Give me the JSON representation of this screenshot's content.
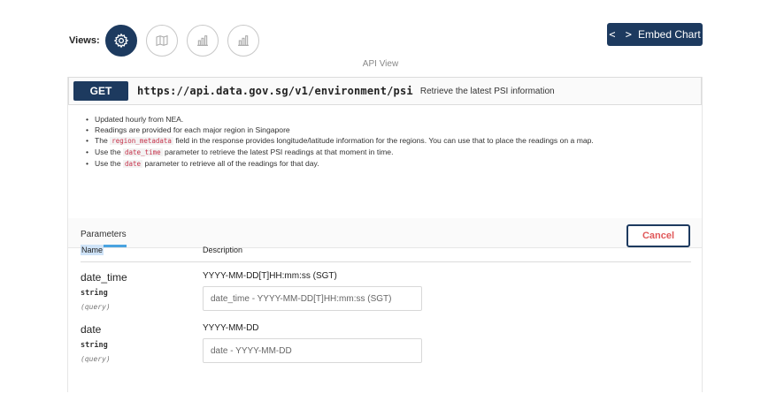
{
  "views": {
    "label": "Views:",
    "buttons": [
      {
        "icon": "gear-icon",
        "active": true
      },
      {
        "icon": "map-icon",
        "active": false
      },
      {
        "icon": "bar-chart-icon",
        "active": false
      },
      {
        "icon": "bar-chart-icon",
        "active": false
      }
    ]
  },
  "embed": {
    "code_glyph": "< >",
    "label": "Embed Chart"
  },
  "api_view_label": "API View",
  "operation": {
    "method": "GET",
    "path": "https://api.data.gov.sg/v1/environment/psi",
    "summary": "Retrieve the latest PSI information"
  },
  "description": {
    "items": [
      {
        "pre": "Updated hourly from NEA.",
        "code": "",
        "post": ""
      },
      {
        "pre": "Readings are provided for each major region in Singapore",
        "code": "",
        "post": ""
      },
      {
        "pre": "The ",
        "code": "region_metadata",
        "post": " field in the response provides longitude/latitude information for the regions. You can use that to place the readings on a map."
      },
      {
        "pre": "Use the ",
        "code": "date_time",
        "post": " parameter to retrieve the latest PSI readings at that moment in time."
      },
      {
        "pre": "Use the ",
        "code": "date",
        "post": " parameter to retrieve all of the readings for that day."
      }
    ]
  },
  "parameters": {
    "tab_label": "Parameters",
    "cancel_label": "Cancel",
    "headers": {
      "name": "Name",
      "description": "Description"
    },
    "rows": [
      {
        "name": "date_time",
        "type": "string",
        "in": "(query)",
        "description": "YYYY-MM-DD[T]HH:mm:ss (SGT)",
        "placeholder": "date_time - YYYY-MM-DD[T]HH:mm:ss (SGT)"
      },
      {
        "name": "date",
        "type": "string",
        "in": "(query)",
        "description": "YYYY-MM-DD",
        "placeholder": "date - YYYY-MM-DD"
      }
    ]
  },
  "colors": {
    "primary": "#1d3a5f",
    "cancel_text": "#e0585a",
    "tab_underline": "#49a3e0",
    "code_text": "#c5314a"
  }
}
